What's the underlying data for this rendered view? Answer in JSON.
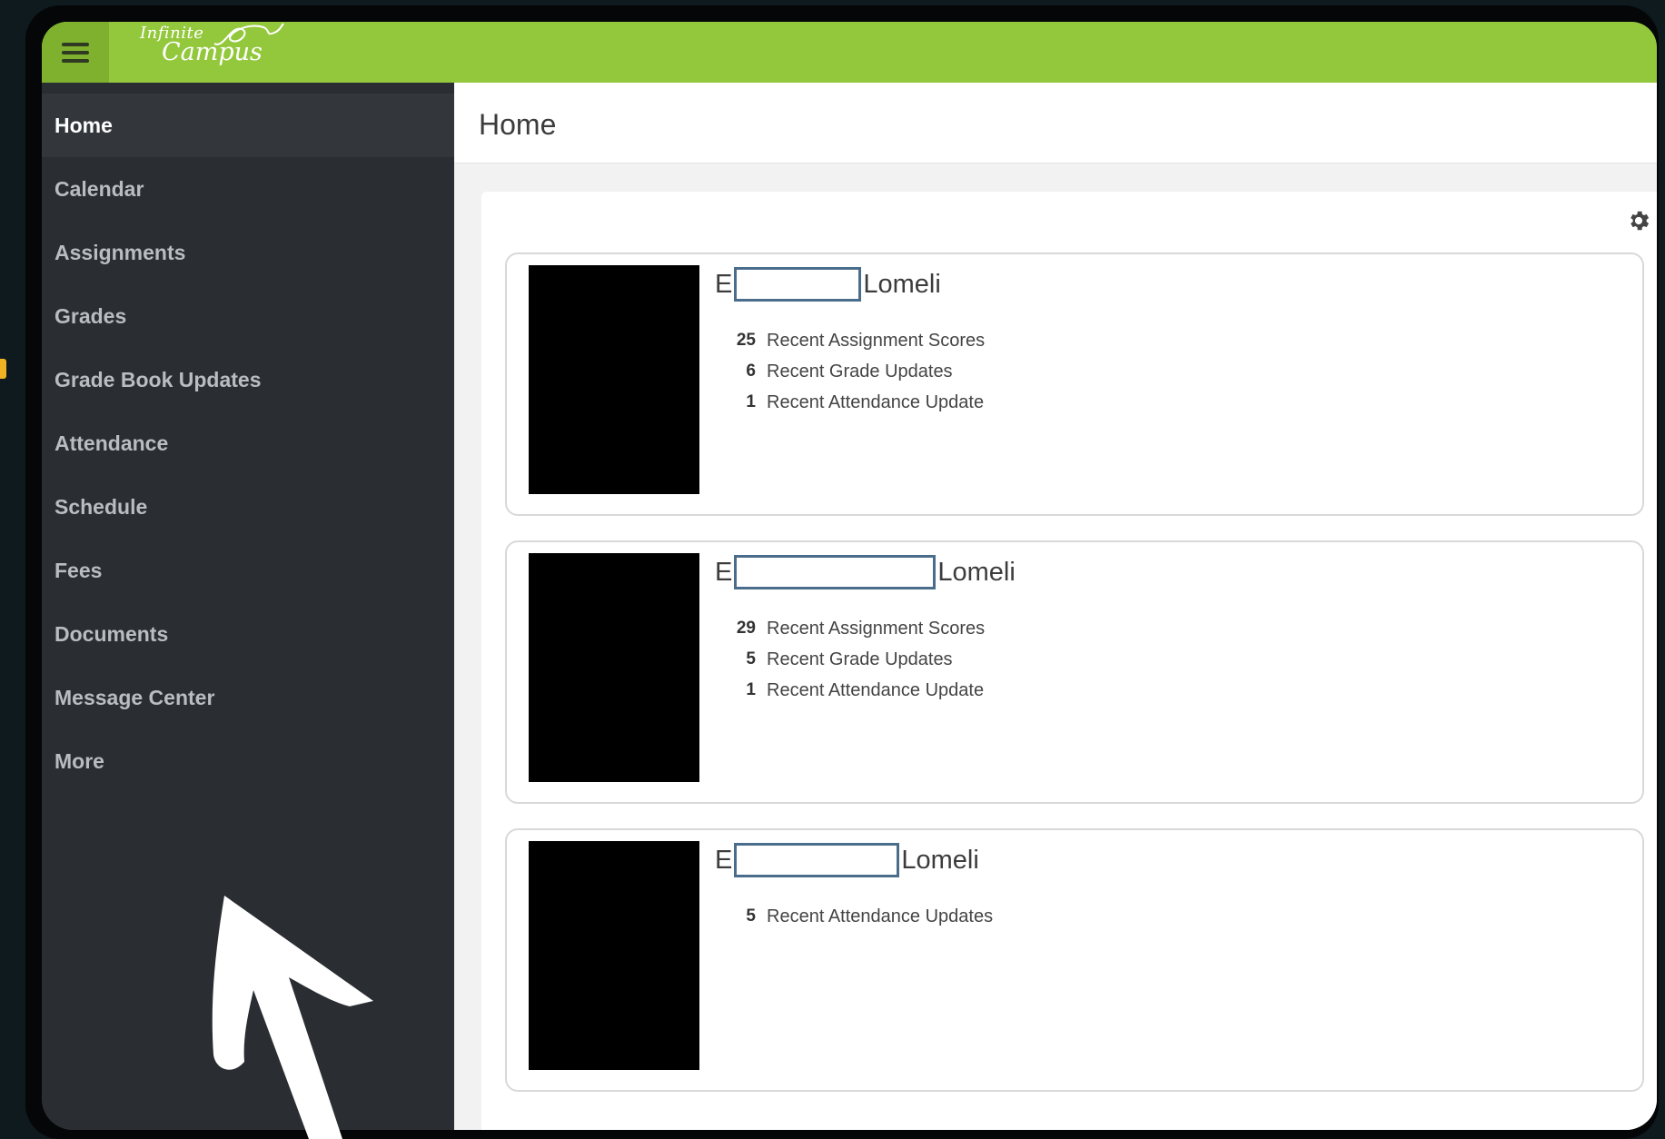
{
  "app": {
    "logo_line1": "Infinite",
    "logo_line2": "Campus",
    "brand_color": "#93c83d"
  },
  "sidebar": {
    "items": [
      {
        "label": "Home",
        "active": true
      },
      {
        "label": "Calendar"
      },
      {
        "label": "Assignments"
      },
      {
        "label": "Grades"
      },
      {
        "label": "Grade Book Updates"
      },
      {
        "label": "Attendance"
      },
      {
        "label": "Schedule"
      },
      {
        "label": "Fees"
      },
      {
        "label": "Documents"
      },
      {
        "label": "Message Center"
      },
      {
        "label": "More"
      }
    ]
  },
  "main": {
    "title": "Home"
  },
  "students": [
    {
      "first_initial": "E",
      "last_name": "Lomeli",
      "stats": [
        {
          "count": "25",
          "label": "Recent Assignment Scores"
        },
        {
          "count": "6",
          "label": "Recent Grade Updates"
        },
        {
          "count": "1",
          "label": "Recent Attendance Update"
        }
      ]
    },
    {
      "first_initial": "E",
      "last_name": "Lomeli",
      "stats": [
        {
          "count": "29",
          "label": "Recent Assignment Scores"
        },
        {
          "count": "5",
          "label": "Recent Grade Updates"
        },
        {
          "count": "1",
          "label": "Recent Attendance Update"
        }
      ]
    },
    {
      "first_initial": "E",
      "last_name": "Lomeli",
      "stats": [
        {
          "count": "5",
          "label": "Recent Attendance Updates"
        }
      ]
    }
  ]
}
